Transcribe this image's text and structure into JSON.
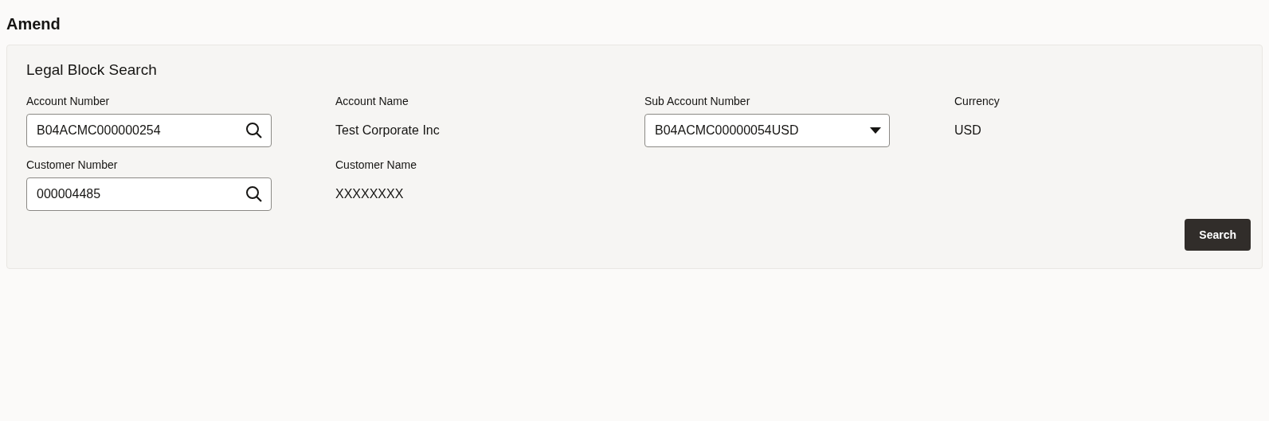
{
  "page_title": "Amend",
  "panel": {
    "title": "Legal Block Search",
    "fields": [
      {
        "kind": "lookup",
        "label": "Account Number",
        "value": "B04ACMC000000254"
      },
      {
        "kind": "text",
        "label": "Account Name",
        "value": "Test Corporate Inc"
      },
      {
        "kind": "select",
        "label": "Sub Account Number",
        "value": "B04ACMC00000054USD"
      },
      {
        "kind": "text",
        "label": "Currency",
        "value": "USD"
      },
      {
        "kind": "lookup",
        "label": "Customer Number",
        "value": "000004485"
      },
      {
        "kind": "text",
        "label": "Customer Name",
        "value": "XXXXXXXX"
      }
    ],
    "button": "Search"
  }
}
